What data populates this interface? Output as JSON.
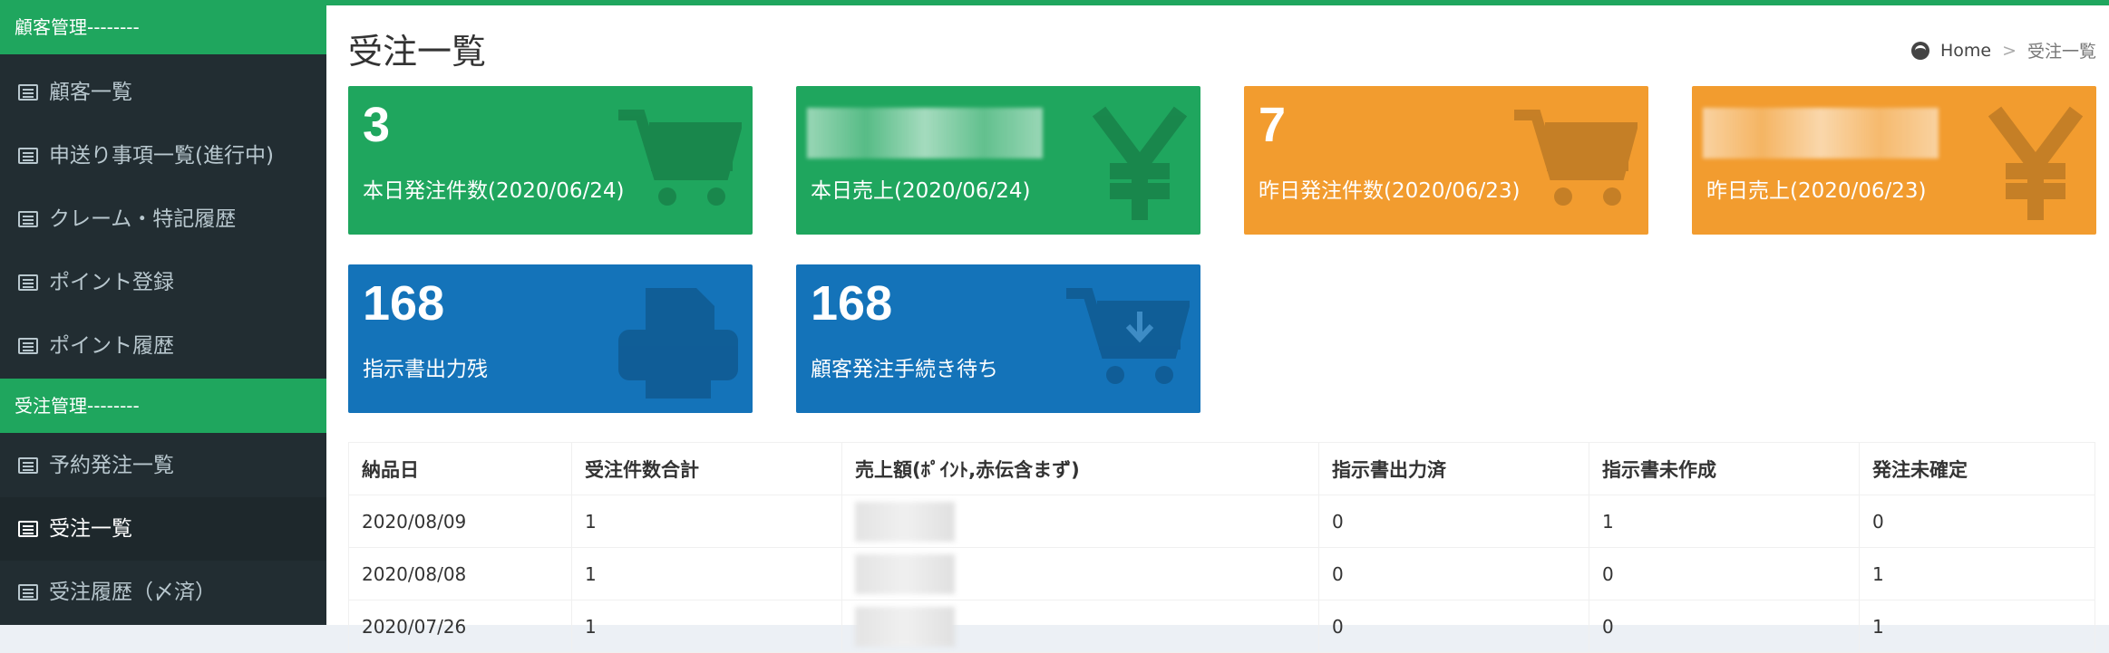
{
  "sidebar": {
    "section1": "顧客管理--------",
    "items1": [
      "顧客一覧",
      "申送り事項一覧(進行中)",
      "クレーム・特記履歴",
      "ポイント登録",
      "ポイント履歴"
    ],
    "section2": "受注管理--------",
    "items2": [
      "予約発注一覧",
      "受注一覧",
      "受注履歴（〆済）"
    ]
  },
  "header": {
    "title": "受注一覧",
    "breadcrumb_home": "Home",
    "breadcrumb_sep": ">",
    "breadcrumb_current": "受注一覧"
  },
  "boxes": [
    {
      "value": "3",
      "label": "本日発注件数(2020/06/24)",
      "icon": "cart-icon"
    },
    {
      "value": "",
      "label": "本日売上(2020/06/24)",
      "icon": "yen-icon"
    },
    {
      "value": "7",
      "label": "昨日発注件数(2020/06/23)",
      "icon": "cart-icon"
    },
    {
      "value": "",
      "label": "昨日売上(2020/06/23)",
      "icon": "yen-icon"
    },
    {
      "value": "168",
      "label": "指示書出力残",
      "icon": "printer-icon"
    },
    {
      "value": "168",
      "label": "顧客発注手続き待ち",
      "icon": "cart-download-icon"
    }
  ],
  "colors": {
    "green": "#1fa65e",
    "orange": "#f29c2f",
    "blue": "#1473b9",
    "sidebar": "#222d32"
  },
  "table": {
    "headers": [
      "納品日",
      "受注件数合計",
      "売上額(ﾎﾟｲﾝﾄ,赤伝含まず)",
      "指示書出力済",
      "指示書未作成",
      "発注未確定"
    ],
    "rows": [
      [
        "2020/08/09",
        "1",
        "",
        "0",
        "1",
        "0"
      ],
      [
        "2020/08/08",
        "1",
        "",
        "0",
        "0",
        "1"
      ],
      [
        "2020/07/26",
        "1",
        "",
        "0",
        "0",
        "1"
      ]
    ]
  }
}
